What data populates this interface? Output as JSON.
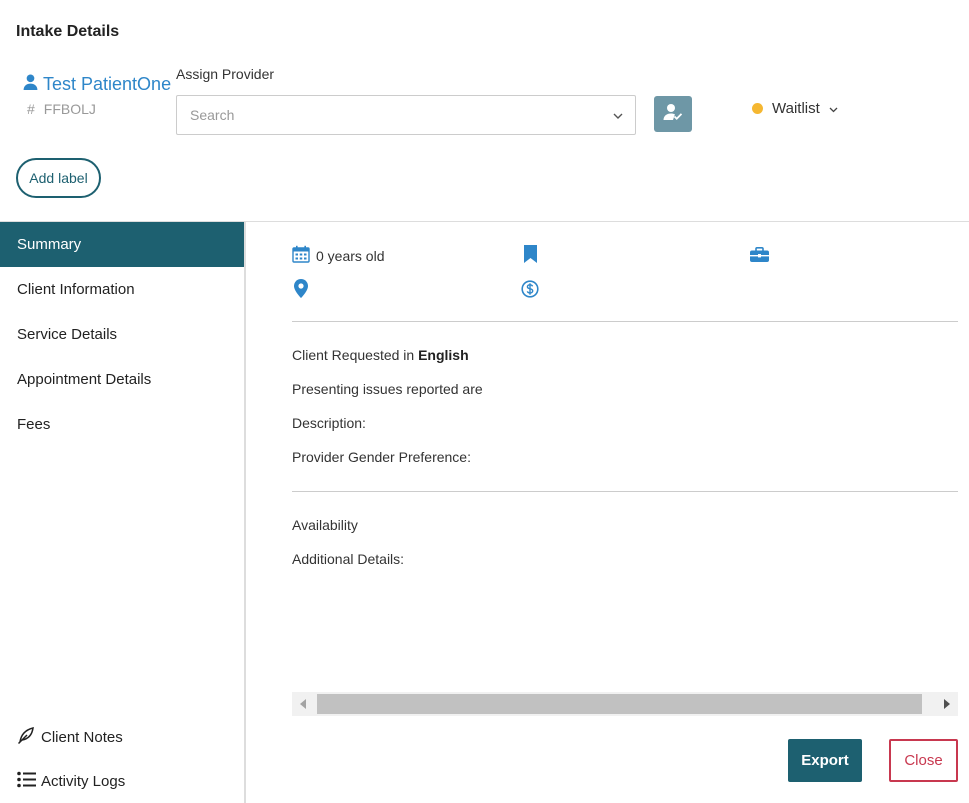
{
  "header": {
    "title": "Intake Details",
    "patient_name": "Test PatientOne",
    "patient_id_prefix": "#",
    "patient_id": "FFBOLJ",
    "assign_provider_label": "Assign Provider",
    "search_placeholder": "Search",
    "status": "Waitlist",
    "status_color": "#f5b731",
    "add_label": "Add label"
  },
  "sidebar": {
    "items": [
      {
        "label": "Summary",
        "active": true
      },
      {
        "label": "Client Information",
        "active": false
      },
      {
        "label": "Service Details",
        "active": false
      },
      {
        "label": "Appointment Details",
        "active": false
      },
      {
        "label": "Fees",
        "active": false
      }
    ],
    "bottom": {
      "client_notes": "Client Notes",
      "activity_logs": "Activity Logs"
    }
  },
  "summary": {
    "age": "0 years old",
    "language_prefix": "Client Requested in",
    "language": "English",
    "presenting_issues": "Presenting issues reported are",
    "description": "Description:",
    "gender_preference": "Provider Gender Preference:",
    "availability": "Availability",
    "additional_details": "Additional Details:"
  },
  "actions": {
    "export": "Export",
    "close": "Close"
  },
  "colors": {
    "primary": "#1d6070",
    "link_blue": "#2e86c9",
    "danger": "#c8384f"
  },
  "icons": [
    "user-icon",
    "chevron-down-icon",
    "assign-user-icon",
    "calendar-icon",
    "bookmark-icon",
    "briefcase-icon",
    "map-pin-icon",
    "dollar-circle-icon",
    "feather-pen-icon",
    "list-icon"
  ]
}
